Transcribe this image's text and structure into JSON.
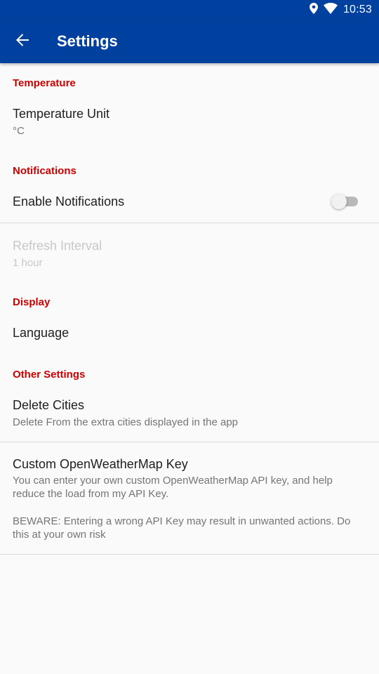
{
  "status_bar": {
    "time": "10:53",
    "icons": [
      "location-icon",
      "wifi-icon"
    ]
  },
  "app_bar": {
    "title": "Settings",
    "back_icon": "arrow-back-icon"
  },
  "sections": {
    "temperature": {
      "header": "Temperature",
      "unit_title": "Temperature Unit",
      "unit_value": "°C"
    },
    "notifications": {
      "header": "Notifications",
      "enable_title": "Enable Notifications",
      "enable_state": false,
      "refresh_title": "Refresh Interval",
      "refresh_value": "1 hour"
    },
    "display": {
      "header": "Display",
      "language_title": "Language"
    },
    "other": {
      "header": "Other Settings",
      "delete_title": "Delete Cities",
      "delete_summary": "Delete From the extra cities displayed in the app",
      "key_title": "Custom OpenWeatherMap Key",
      "key_summary_1": "You can enter your own custom OpenWeatherMap API key, and help reduce the load from my API Key.",
      "key_summary_2": "BEWARE: Entering a wrong API Key may result in unwanted actions. Do this at your own risk"
    }
  },
  "colors": {
    "primary": "#0041a0",
    "category_accent": "#cc0000",
    "background": "#fafafa"
  }
}
